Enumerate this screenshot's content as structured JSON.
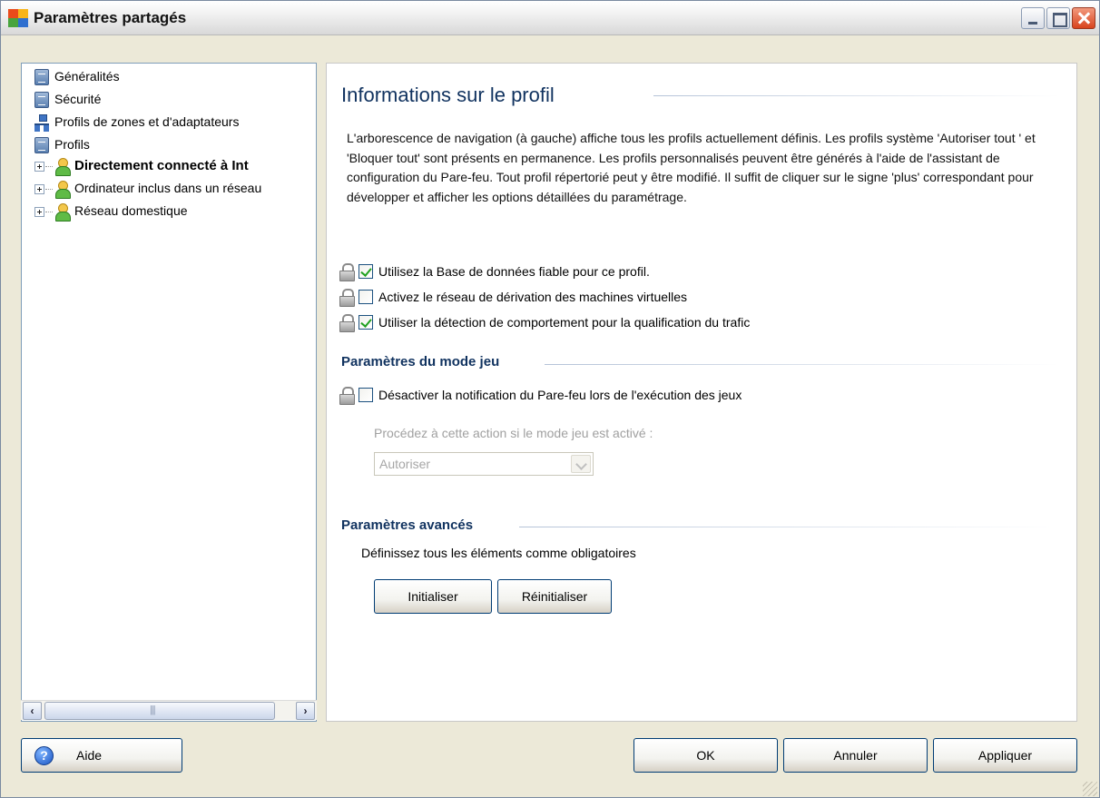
{
  "window": {
    "title": "Paramètres partagés"
  },
  "tree": {
    "items": [
      {
        "label": "Généralités",
        "icon": "document-icon"
      },
      {
        "label": "Sécurité",
        "icon": "document-icon"
      },
      {
        "label": "Profils de zones et d'adaptateurs",
        "icon": "network-icon"
      },
      {
        "label": "Profils",
        "icon": "document-icon"
      },
      {
        "label": "Directement connecté à Int",
        "icon": "user-icon",
        "selected": true
      },
      {
        "label": "Ordinateur inclus dans un réseau",
        "icon": "user-icon"
      },
      {
        "label": "Réseau domestique",
        "icon": "user-icon"
      }
    ]
  },
  "main": {
    "heading": "Informations sur le profil",
    "description": "L'arborescence de navigation (à gauche) affiche tous les profils actuellement définis. Les profils système 'Autoriser tout ' et 'Bloquer tout' sont présents en permanence. Les profils personnalisés peuvent être générés à l'aide de l'assistant de configuration du Pare-feu. Tout profil répertorié peut y être modifié. Il suffit de cliquer sur le signe 'plus' correspondant pour développer et afficher les options détaillées du paramétrage.",
    "options": [
      {
        "label": "Utilisez la Base de données fiable pour ce profil.",
        "checked": true
      },
      {
        "label": "Activez le réseau de dérivation des machines virtuelles",
        "checked": false
      },
      {
        "label": "Utiliser la détection de comportement pour la qualification du trafic",
        "checked": true
      }
    ],
    "game_mode": {
      "heading": "Paramètres du mode jeu",
      "option": {
        "label": "Désactiver la notification du Pare-feu lors de l'exécution des jeux",
        "checked": false
      },
      "action_label": "Procédez à cette action si le mode jeu est activé :",
      "action_value": "Autoriser"
    },
    "advanced": {
      "heading": "Paramètres avancés",
      "text": "Définissez tous les éléments comme obligatoires",
      "init_label": "Initialiser",
      "reinit_label": "Réinitialiser"
    }
  },
  "footer": {
    "help_label": "Aide",
    "ok_label": "OK",
    "cancel_label": "Annuler",
    "apply_label": "Appliquer"
  },
  "colors": {
    "heading": "#10325f",
    "check": "#21a121",
    "close_button": "#d8431d"
  }
}
